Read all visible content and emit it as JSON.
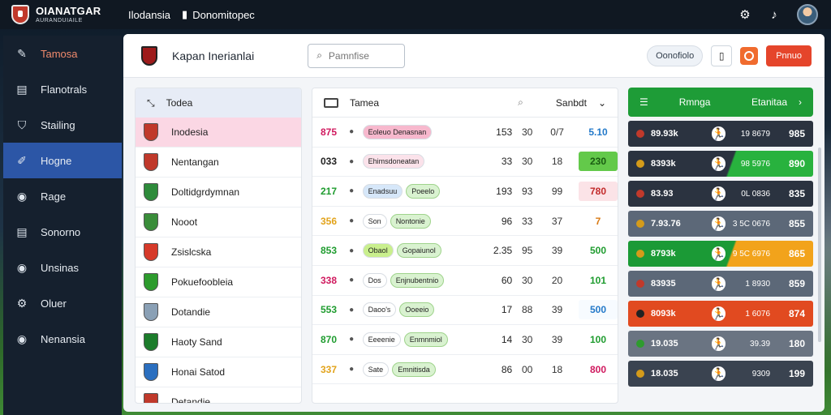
{
  "brand": {
    "title": "OIANATGAR",
    "subtitle": "AURANDUIAILE"
  },
  "top_nav": [
    {
      "label": "Ilodansia",
      "icon": "none"
    },
    {
      "label": "Donomitopec",
      "icon": "book-icon"
    }
  ],
  "sidebar": {
    "items": [
      {
        "label": "Tamosa",
        "icon": "pencil-icon"
      },
      {
        "label": "Flanotrals",
        "icon": "table-icon"
      },
      {
        "label": "Stailing",
        "icon": "shield-icon"
      },
      {
        "label": "Hogne",
        "icon": "edit-icon",
        "active": true
      },
      {
        "label": "Rage",
        "icon": "globe-icon"
      },
      {
        "label": "Sonorno",
        "icon": "table-icon"
      },
      {
        "label": "Unsinas",
        "icon": "globe-icon"
      },
      {
        "label": "Oluer",
        "icon": "gear-icon"
      },
      {
        "label": "Nenansia",
        "icon": "globe-icon"
      }
    ]
  },
  "header": {
    "title": "Kapan Inerianlai",
    "search_placeholder": "Pamnfise",
    "pill_label": "Oonofiolo",
    "red_button": "Pnnuo"
  },
  "left_panel": {
    "head_label": "Todea",
    "rows": [
      {
        "label": "Inodesia",
        "crest": "#c0392b"
      },
      {
        "label": "Nentangan",
        "crest": "#c0392b"
      },
      {
        "label": "Doltidgrdymnan",
        "crest": "#2e8b3b"
      },
      {
        "label": "Nooot",
        "crest": "#3a8d3a"
      },
      {
        "label": "Zsislcska",
        "crest": "#d63a2a"
      },
      {
        "label": "Pokuefoobleia",
        "crest": "#2d9b2d"
      },
      {
        "label": "Dotandie",
        "crest": "#8aa0b5"
      },
      {
        "label": "Haoty Sand",
        "crest": "#1c7c2b"
      },
      {
        "label": "Honai Satod",
        "crest": "#2b6fbf"
      },
      {
        "label": "Detandie",
        "crest": "#c0392b"
      }
    ]
  },
  "mid_panel": {
    "head_label": "Tamea",
    "head_right": "Sanbdt",
    "rows": [
      {
        "rank": "875",
        "rank_color": "#d0195e",
        "chip_a": "Eoleuo Denasnan",
        "chip_a_bg": "#f7b8cd",
        "chip_b": "",
        "n1": "153",
        "n2": "30",
        "n3": "0/7",
        "score": "5.10",
        "score_color": "#2379c9",
        "score_bg": "transparent"
      },
      {
        "rank": "033",
        "rank_color": "#222",
        "chip_a": "Ehimsdoneatan",
        "chip_a_bg": "#fbe2ea",
        "chip_b": "",
        "n1": "33",
        "n2": "30",
        "n3": "18",
        "score": "230",
        "score_color": "#1a5c12",
        "score_bg": "#63c94a"
      },
      {
        "rank": "217",
        "rank_color": "#1f9c2f",
        "chip_a": "Enadsuu",
        "chip_a_bg": "#d6e7f9",
        "chip_b": "Poeelo",
        "n1": "193",
        "n2": "93",
        "n3": "99",
        "score": "780",
        "score_color": "#c22a2a",
        "score_bg": "#fbe3e7"
      },
      {
        "rank": "356",
        "rank_color": "#e2a31b",
        "chip_a": "Son",
        "chip_a_bg": "#fff",
        "chip_b": "Nontonie",
        "n1": "96",
        "n2": "33",
        "n3": "37",
        "score": "7",
        "score_color": "#d97a14",
        "score_bg": "transparent"
      },
      {
        "rank": "853",
        "rank_color": "#1f9c2f",
        "chip_a": "Obaol",
        "chip_a_bg": "#c9ef8d",
        "chip_b": "Gopaiunol",
        "n1": "2.35",
        "n2": "95",
        "n3": "39",
        "score": "500",
        "score_color": "#1f9c2f",
        "score_bg": "transparent"
      },
      {
        "rank": "338",
        "rank_color": "#d0195e",
        "chip_a": "Dos",
        "chip_a_bg": "#fff",
        "chip_b": "Enjnubentnio",
        "n1": "60",
        "n2": "30",
        "n3": "20",
        "score": "101",
        "score_color": "#1f9c2f",
        "score_bg": "transparent"
      },
      {
        "rank": "553",
        "rank_color": "#1f9c2f",
        "chip_a": "Daoo's",
        "chip_a_bg": "#fff",
        "chip_b": "Ooeeio",
        "n1": "17",
        "n2": "88",
        "n3": "39",
        "score": "500",
        "score_color": "#2379c9",
        "score_bg": "#f7fbff"
      },
      {
        "rank": "870",
        "rank_color": "#1f9c2f",
        "chip_a": "Eeeenie",
        "chip_a_bg": "#fff",
        "chip_b": "Enmnmiol",
        "n1": "14",
        "n2": "30",
        "n3": "39",
        "score": "100",
        "score_color": "#1f9c2f",
        "score_bg": "transparent"
      },
      {
        "rank": "337",
        "rank_color": "#e2a31b",
        "chip_a": "Sate",
        "chip_a_bg": "#fff",
        "chip_b": "Emnitisda",
        "n1": "86",
        "n2": "00",
        "n3": "18",
        "score": "800",
        "score_color": "#d0195e",
        "score_bg": "transparent"
      }
    ]
  },
  "right_panel": {
    "head_left": "Rmnga",
    "head_right": "Etanitaa",
    "rows": [
      {
        "v1": "89.93k",
        "v2": "19 8679",
        "v3": "985",
        "bg": "#2b3340",
        "accent": "#2b3340",
        "icon": "#c0392b"
      },
      {
        "v1": "8393k",
        "v2": "98 5976",
        "v3": "890",
        "bg": "#2b3340",
        "accent": "#28b23e",
        "icon": "#d49b1a"
      },
      {
        "v1": "83.93",
        "v2": "0L 0836",
        "v3": "835",
        "bg": "#2b3340",
        "accent": "#2b3340",
        "icon": "#c0392b"
      },
      {
        "v1": "7.93.76",
        "v2": "3 5C 0676",
        "v3": "855",
        "bg": "#5c6878",
        "accent": "#5c6878",
        "icon": "#d49b1a"
      },
      {
        "v1": "8793k",
        "v2": "9 5C 6976",
        "v3": "865",
        "bg": "#1b9a36",
        "accent": "#f2a31b",
        "icon": "#d49b1a"
      },
      {
        "v1": "83935",
        "v2": "1 8930",
        "v3": "859",
        "bg": "#5c6878",
        "accent": "#5c6878",
        "icon": "#c0392b"
      },
      {
        "v1": "8093k",
        "v2": "1 6076",
        "v3": "874",
        "bg": "#e14a20",
        "accent": "#e14a20",
        "icon": "#222"
      },
      {
        "v1": "19.035",
        "v2": "39.39",
        "v3": "180",
        "bg": "#6a7482",
        "accent": "#6a7482",
        "icon": "#2e9b2e"
      },
      {
        "v1": "18.035",
        "v2": "9309",
        "v3": "199",
        "bg": "#3a4350",
        "accent": "#3a4350",
        "icon": "#d49b1a"
      }
    ]
  }
}
